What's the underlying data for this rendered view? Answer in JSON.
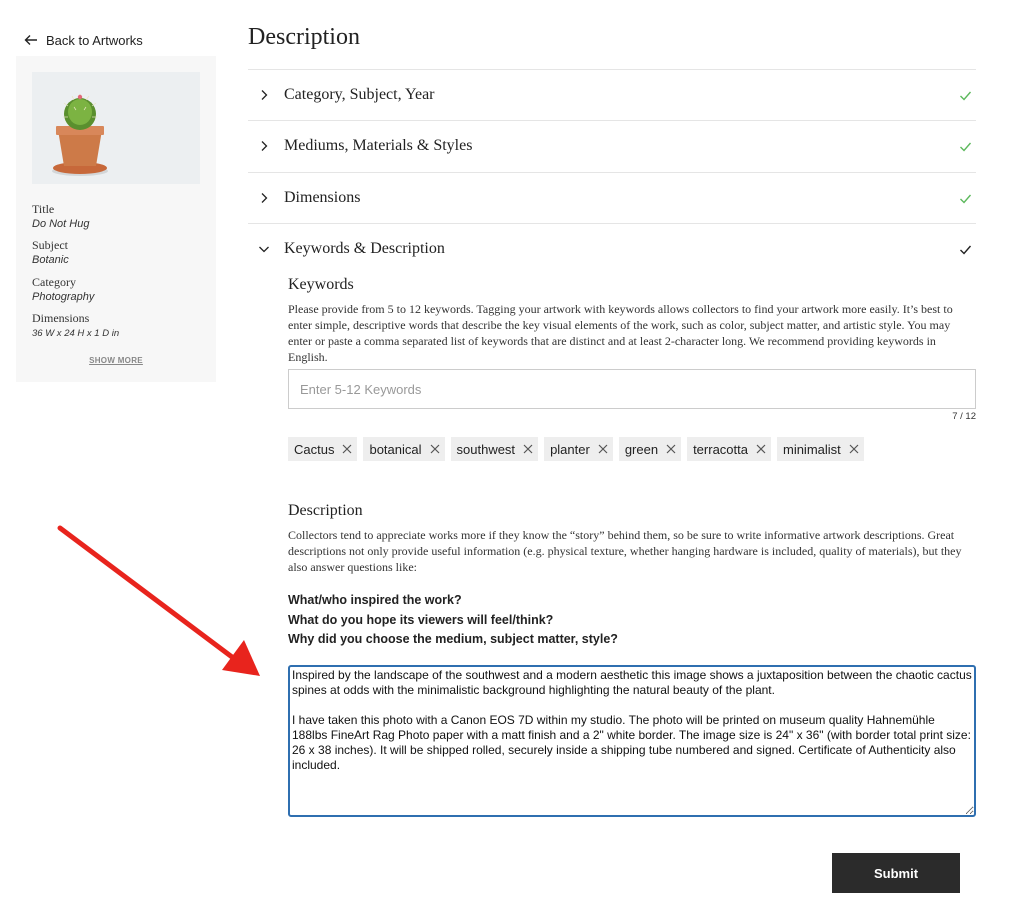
{
  "back_link": {
    "label": "Back to Artworks"
  },
  "summary": {
    "fields": [
      {
        "label": "Title",
        "value": "Do Not Hug"
      },
      {
        "label": "Subject",
        "value": "Botanic"
      },
      {
        "label": "Category",
        "value": "Photography"
      },
      {
        "label": "Dimensions",
        "value": "36 W x 24 H x 1 D in"
      }
    ],
    "show_more": "SHOW MORE"
  },
  "main": {
    "title": "Description",
    "sections": [
      {
        "label": "Category, Subject, Year",
        "state": "collapsed-complete"
      },
      {
        "label": "Mediums, Materials & Styles",
        "state": "collapsed-complete"
      },
      {
        "label": "Dimensions",
        "state": "collapsed-complete"
      },
      {
        "label": "Keywords & Description",
        "state": "expanded"
      }
    ]
  },
  "keywords": {
    "heading": "Keywords",
    "help": "Please provide from 5 to 12 keywords. Tagging your artwork with keywords allows collectors to find your artwork more easily. It’s best to enter simple, descriptive words that describe the key visual elements of the work, such as color, subject matter, and artistic style. You may enter or paste a comma separated list of keywords that are distinct and at least 2-character long. We recommend providing keywords in English.",
    "placeholder": "Enter 5-12 Keywords",
    "count": "7 / 12",
    "tags": [
      "Cactus",
      "botanical",
      "southwest",
      "planter",
      "green",
      "terracotta",
      "minimalist"
    ]
  },
  "description": {
    "heading": "Description",
    "help": "Collectors tend to appreciate works more if they know the “story” behind them, so be sure to write informative artwork descriptions. Great descriptions not only provide useful information (e.g. physical texture, whether hanging hardware is included, quality of materials), but they also answer questions like:",
    "questions": [
      "What/who inspired the work?",
      "What do you hope its viewers will feel/think?",
      "Why did you choose the medium, subject matter, style?"
    ],
    "value": "Inspired by the landscape of the southwest and a modern aesthetic this image shows a juxtaposition between the chaotic cactus spines at odds with the minimalistic background highlighting the natural beauty of the plant.\n\nI have taken this photo with a Canon EOS 7D within my studio. The photo will be printed on museum quality Hahnemühle 188lbs FineArt Rag Photo paper with a matt finish and a 2\" white border. The image size is 24\" x 36\" (with border total print size: 26 x 38 inches). It will be shipped rolled, securely inside a shipping tube numbered and signed. Certificate of Authenticity also included.\n"
  },
  "submit_label": "Submit",
  "colors": {
    "accent": "#2f6fb0",
    "check_complete": "#5cb85c",
    "annotation": "#e8241d",
    "button": "#2b2b2b"
  }
}
